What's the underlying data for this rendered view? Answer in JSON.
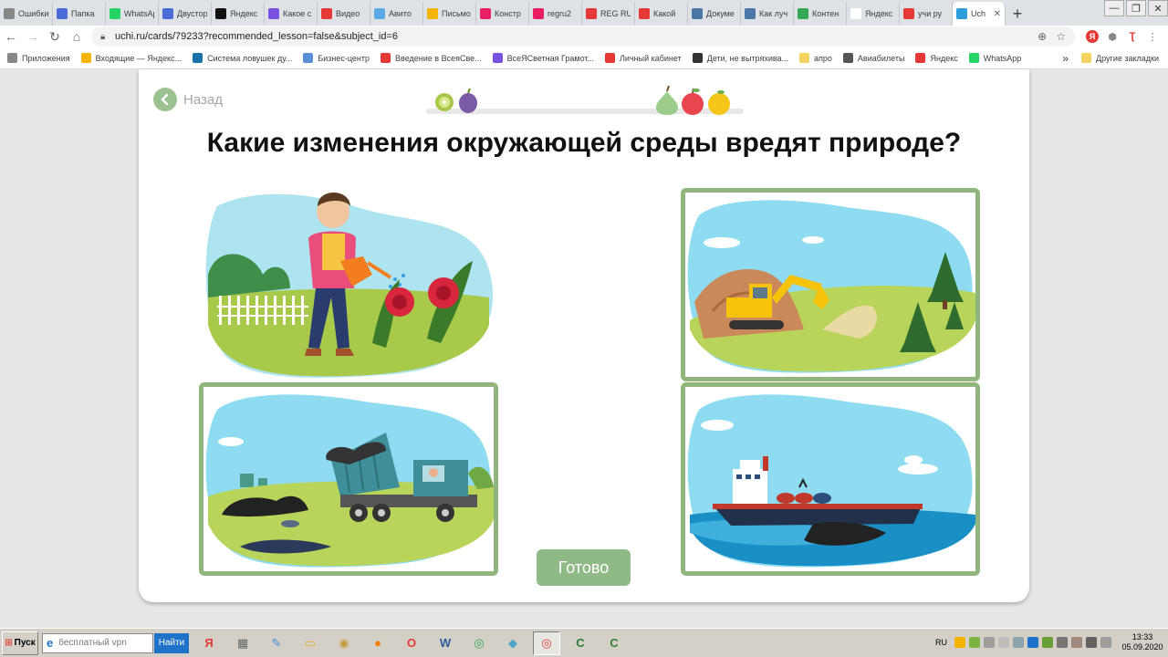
{
  "browser": {
    "tabs": [
      {
        "title": "Ошибки",
        "color": "#888888"
      },
      {
        "title": "Папка",
        "color": "#4a6bd8"
      },
      {
        "title": "WhatsApp",
        "color": "#25d366"
      },
      {
        "title": "Двустор",
        "color": "#4a6bd8"
      },
      {
        "title": "Яндекс",
        "color": "#111111"
      },
      {
        "title": "Какое с",
        "color": "#7b52e0"
      },
      {
        "title": "Видео",
        "color": "#e53935"
      },
      {
        "title": "Авито",
        "color": "#5aa9e6"
      },
      {
        "title": "Письмо",
        "color": "#f4b400"
      },
      {
        "title": "Констр",
        "color": "#e91e63"
      },
      {
        "title": "regru2",
        "color": "#e91e63"
      },
      {
        "title": "REG RU",
        "color": "#e53935"
      },
      {
        "title": "Какой",
        "color": "#e53935"
      },
      {
        "title": "Докуме",
        "color": "#4a76a8"
      },
      {
        "title": "Как луч",
        "color": "#4a76a8"
      },
      {
        "title": "Контен",
        "color": "#34a853"
      },
      {
        "title": "Яндекс",
        "color": "#ffffff"
      },
      {
        "title": "учи ру",
        "color": "#e53935"
      },
      {
        "title": "Uch",
        "color": "#2d9cdb"
      }
    ],
    "new_tab": "+",
    "url": "uchi.ru/cards/79233?recommended_lesson=false&subject_id=6",
    "bookmarks": [
      {
        "label": "Приложения",
        "color": "#888888"
      },
      {
        "label": "Входящие — Яндекс...",
        "color": "#f4b400"
      },
      {
        "label": "Система ловушек ду...",
        "color": "#1a73a8"
      },
      {
        "label": "Бизнес-центр",
        "color": "#5a8fd8"
      },
      {
        "label": "Введение в ВсеяСве...",
        "color": "#e53935"
      },
      {
        "label": "ВсеЯСветная Грамот...",
        "color": "#7b52e0"
      },
      {
        "label": "Личный кабинет",
        "color": "#e53935"
      },
      {
        "label": "Дети, не вытряхива...",
        "color": "#333333"
      },
      {
        "label": "апро",
        "color": "#f4d35e"
      },
      {
        "label": "Авиабилеты",
        "color": "#555555"
      },
      {
        "label": "Яндекс",
        "color": "#e53935"
      },
      {
        "label": "WhatsApp",
        "color": "#25d366"
      }
    ],
    "other_bookmarks": "Другие закладки",
    "more": "»"
  },
  "page": {
    "back_label": "Назад",
    "question": "Какие изменения окружающей среды вредят природе?",
    "done_label": "Готово",
    "options": [
      {
        "id": "watering-flowers",
        "selected": false
      },
      {
        "id": "excavator",
        "selected": true
      },
      {
        "id": "garbage-truck",
        "selected": true
      },
      {
        "id": "oil-tanker",
        "selected": true
      }
    ],
    "colors": {
      "accent": "#90b67e",
      "button": "#8fba86"
    }
  },
  "taskbar": {
    "start": "Пуск",
    "search_placeholder": "бесплатный vpn",
    "search_button": "Найти",
    "language": "RU",
    "time": "13:33",
    "date": "05.09.2020"
  }
}
